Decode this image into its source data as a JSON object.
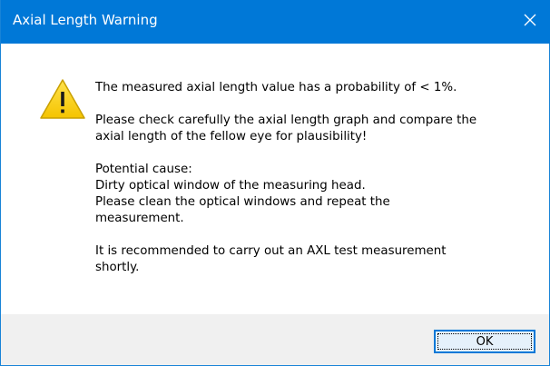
{
  "window": {
    "title": "Axial Length Warning",
    "close_icon": "close-icon",
    "accent_color": "#0078d7"
  },
  "message": {
    "icon": "warning-icon",
    "paragraphs": [
      "The measured axial length value has a probability of < 1%.",
      "Please check carefully the axial length graph and compare the\naxial length of the fellow eye for plausibility!",
      "Potential cause:\nDirty optical window of the measuring head.\nPlease clean the optical windows and repeat the\nmeasurement.",
      "It is recommended to carry out an AXL test measurement\nshortly."
    ]
  },
  "buttons": {
    "ok_label": "OK"
  }
}
